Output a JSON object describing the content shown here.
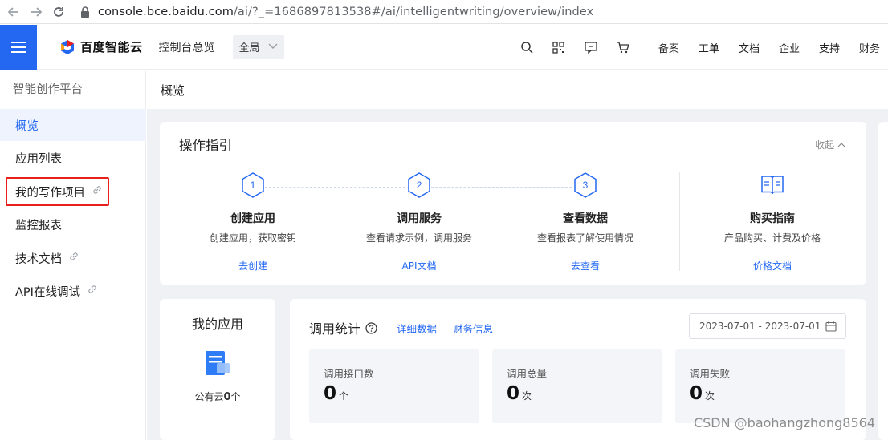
{
  "browser": {
    "url_host": "console.bce.baidu.com",
    "url_path": "/ai/?_=1686897813538#/ai/intelligentwriting/overview/index"
  },
  "header": {
    "logo_text": "百度智能云",
    "console_home": "控制台总览",
    "region": "全局",
    "links": [
      "备案",
      "工单",
      "文档",
      "企业",
      "支持",
      "财务"
    ]
  },
  "sidebar": {
    "title": "智能创作平台",
    "items": [
      {
        "label": "概览",
        "active": true
      },
      {
        "label": "应用列表"
      },
      {
        "label": "我的写作项目",
        "external": true
      },
      {
        "label": "监控报表"
      },
      {
        "label": "技术文档",
        "external": true
      },
      {
        "label": "API在线调试",
        "external": true
      }
    ]
  },
  "main": {
    "breadcrumb": "概览",
    "guide": {
      "title": "操作指引",
      "collapse_label": "收起",
      "steps": [
        {
          "num": "1",
          "title": "创建应用",
          "desc": "创建应用，获取密钥",
          "link": "去创建"
        },
        {
          "num": "2",
          "title": "调用服务",
          "desc": "查看请求示例，调用服务",
          "link": "API文档"
        },
        {
          "num": "3",
          "title": "查看数据",
          "desc": "查看报表了解使用情况",
          "link": "去查看"
        },
        {
          "num": "",
          "title": "购买指南",
          "desc": "产品购买、计费及价格",
          "link": "价格文档"
        }
      ]
    },
    "my_app": {
      "title": "我的应用",
      "public_cloud_label": "公有云",
      "count": "0",
      "count_unit": "个"
    },
    "stats": {
      "title": "调用统计",
      "link_details": "详细数据",
      "link_finance": "财务信息",
      "date_range": "2023-07-01 - 2023-07-01",
      "boxes": [
        {
          "label": "调用接口数",
          "value": "0",
          "unit": "个"
        },
        {
          "label": "调用总量",
          "value": "0",
          "unit": "次"
        },
        {
          "label": "调用失败",
          "value": "0",
          "unit": "次"
        }
      ]
    }
  },
  "watermark": "CSDN @baohangzhong8564",
  "colors": {
    "accent": "#2468f2",
    "highlight_box": "#e8201b"
  }
}
